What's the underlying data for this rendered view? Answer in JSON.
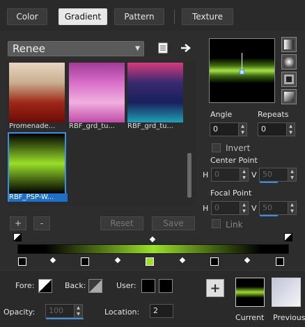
{
  "tabs": [
    "Color",
    "Gradient",
    "Pattern",
    "Texture"
  ],
  "active_tab": "Gradient",
  "preset": {
    "value": "Renee"
  },
  "presets": [
    {
      "name": "Promenade...",
      "colors": [
        "#e8d4c0",
        "#c8b090",
        "#a02818",
        "#6a0c08"
      ]
    },
    {
      "name": "RBF_grd_tu...",
      "colors": [
        "#a23a98",
        "#d86ec8",
        "#f0b0e0",
        "#c04aa8"
      ]
    },
    {
      "name": "RBF_grd_tu...",
      "colors": [
        "#d83a7c",
        "#3a2a70",
        "#18205a",
        "#20a0b8"
      ]
    },
    {
      "name": "RBF_PSP-W...",
      "colors": [
        "#000000",
        "#9adf2a",
        "#000000"
      ],
      "selected": true
    }
  ],
  "buttons": {
    "add": "+",
    "remove": "-",
    "reset": "Reset",
    "save": "Save"
  },
  "angle": {
    "label": "Angle",
    "value": "0"
  },
  "repeats": {
    "label": "Repeats",
    "value": "0"
  },
  "invert": {
    "label": "Invert"
  },
  "center_point": {
    "label": "Center Point",
    "h_label": "H",
    "h_value": "0",
    "v_label": "V",
    "v_value": "50"
  },
  "focal_point": {
    "label": "Focal Point",
    "h_label": "H",
    "h_value": "0",
    "v_label": "V",
    "v_value": "50"
  },
  "link": {
    "label": "Link"
  },
  "footer": {
    "fore_label": "Fore:",
    "back_label": "Back:",
    "user_label": "User:",
    "opacity_label": "Opacity:",
    "opacity_value": "100",
    "location_label": "Location:",
    "location_value": "2",
    "current_label": "Current",
    "previous_label": "Previous"
  },
  "icons": {
    "new_preset": "new-document-icon",
    "apply": "arrow-right-icon",
    "gradient_types": [
      "linear-gradient-icon",
      "radial-gradient-icon",
      "rectangular-gradient-icon",
      "sunburst-gradient-icon"
    ]
  },
  "colors": {
    "accent": "#3a8ee6",
    "gradient_green": "#9adf2a"
  }
}
